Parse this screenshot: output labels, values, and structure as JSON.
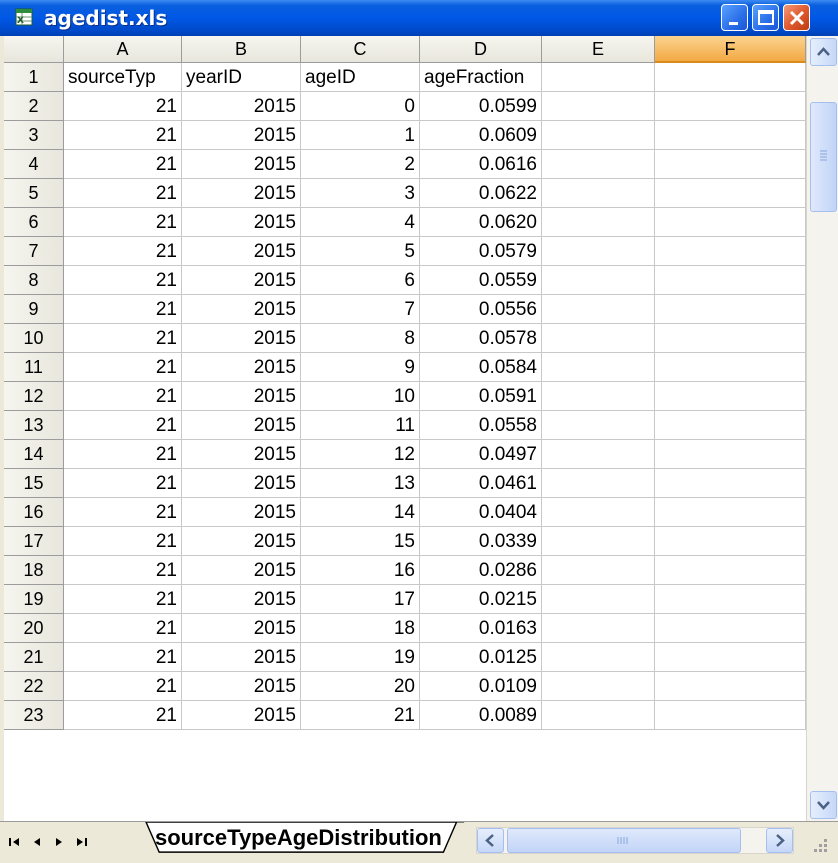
{
  "window": {
    "title": "agedist.xls"
  },
  "columns": [
    "A",
    "B",
    "C",
    "D",
    "E",
    "F"
  ],
  "selected_column": "F",
  "rows": [
    {
      "num": "1",
      "A": "sourceTyp",
      "B": "yearID",
      "C": "ageID",
      "D": "ageFraction",
      "header": true
    },
    {
      "num": "2",
      "A": "21",
      "B": "2015",
      "C": "0",
      "D": "0.0599"
    },
    {
      "num": "3",
      "A": "21",
      "B": "2015",
      "C": "1",
      "D": "0.0609"
    },
    {
      "num": "4",
      "A": "21",
      "B": "2015",
      "C": "2",
      "D": "0.0616"
    },
    {
      "num": "5",
      "A": "21",
      "B": "2015",
      "C": "3",
      "D": "0.0622"
    },
    {
      "num": "6",
      "A": "21",
      "B": "2015",
      "C": "4",
      "D": "0.0620"
    },
    {
      "num": "7",
      "A": "21",
      "B": "2015",
      "C": "5",
      "D": "0.0579"
    },
    {
      "num": "8",
      "A": "21",
      "B": "2015",
      "C": "6",
      "D": "0.0559"
    },
    {
      "num": "9",
      "A": "21",
      "B": "2015",
      "C": "7",
      "D": "0.0556"
    },
    {
      "num": "10",
      "A": "21",
      "B": "2015",
      "C": "8",
      "D": "0.0578"
    },
    {
      "num": "11",
      "A": "21",
      "B": "2015",
      "C": "9",
      "D": "0.0584"
    },
    {
      "num": "12",
      "A": "21",
      "B": "2015",
      "C": "10",
      "D": "0.0591"
    },
    {
      "num": "13",
      "A": "21",
      "B": "2015",
      "C": "11",
      "D": "0.0558"
    },
    {
      "num": "14",
      "A": "21",
      "B": "2015",
      "C": "12",
      "D": "0.0497"
    },
    {
      "num": "15",
      "A": "21",
      "B": "2015",
      "C": "13",
      "D": "0.0461"
    },
    {
      "num": "16",
      "A": "21",
      "B": "2015",
      "C": "14",
      "D": "0.0404"
    },
    {
      "num": "17",
      "A": "21",
      "B": "2015",
      "C": "15",
      "D": "0.0339"
    },
    {
      "num": "18",
      "A": "21",
      "B": "2015",
      "C": "16",
      "D": "0.0286"
    },
    {
      "num": "19",
      "A": "21",
      "B": "2015",
      "C": "17",
      "D": "0.0215"
    },
    {
      "num": "20",
      "A": "21",
      "B": "2015",
      "C": "18",
      "D": "0.0163"
    },
    {
      "num": "21",
      "A": "21",
      "B": "2015",
      "C": "19",
      "D": "0.0125"
    },
    {
      "num": "22",
      "A": "21",
      "B": "2015",
      "C": "20",
      "D": "0.0109"
    },
    {
      "num": "23",
      "A": "21",
      "B": "2015",
      "C": "21",
      "D": "0.0089"
    }
  ],
  "sheet_tab": {
    "label": "sourceTypeAgeDistribution"
  },
  "icons": {
    "app": "excel-file-icon",
    "minimize": "minimize-icon",
    "maximize": "maximize-icon",
    "close": "close-icon"
  },
  "colors": {
    "titlebar": "#0058e6",
    "selected_column_header": "#f3a944",
    "close_button": "#e05b30"
  }
}
